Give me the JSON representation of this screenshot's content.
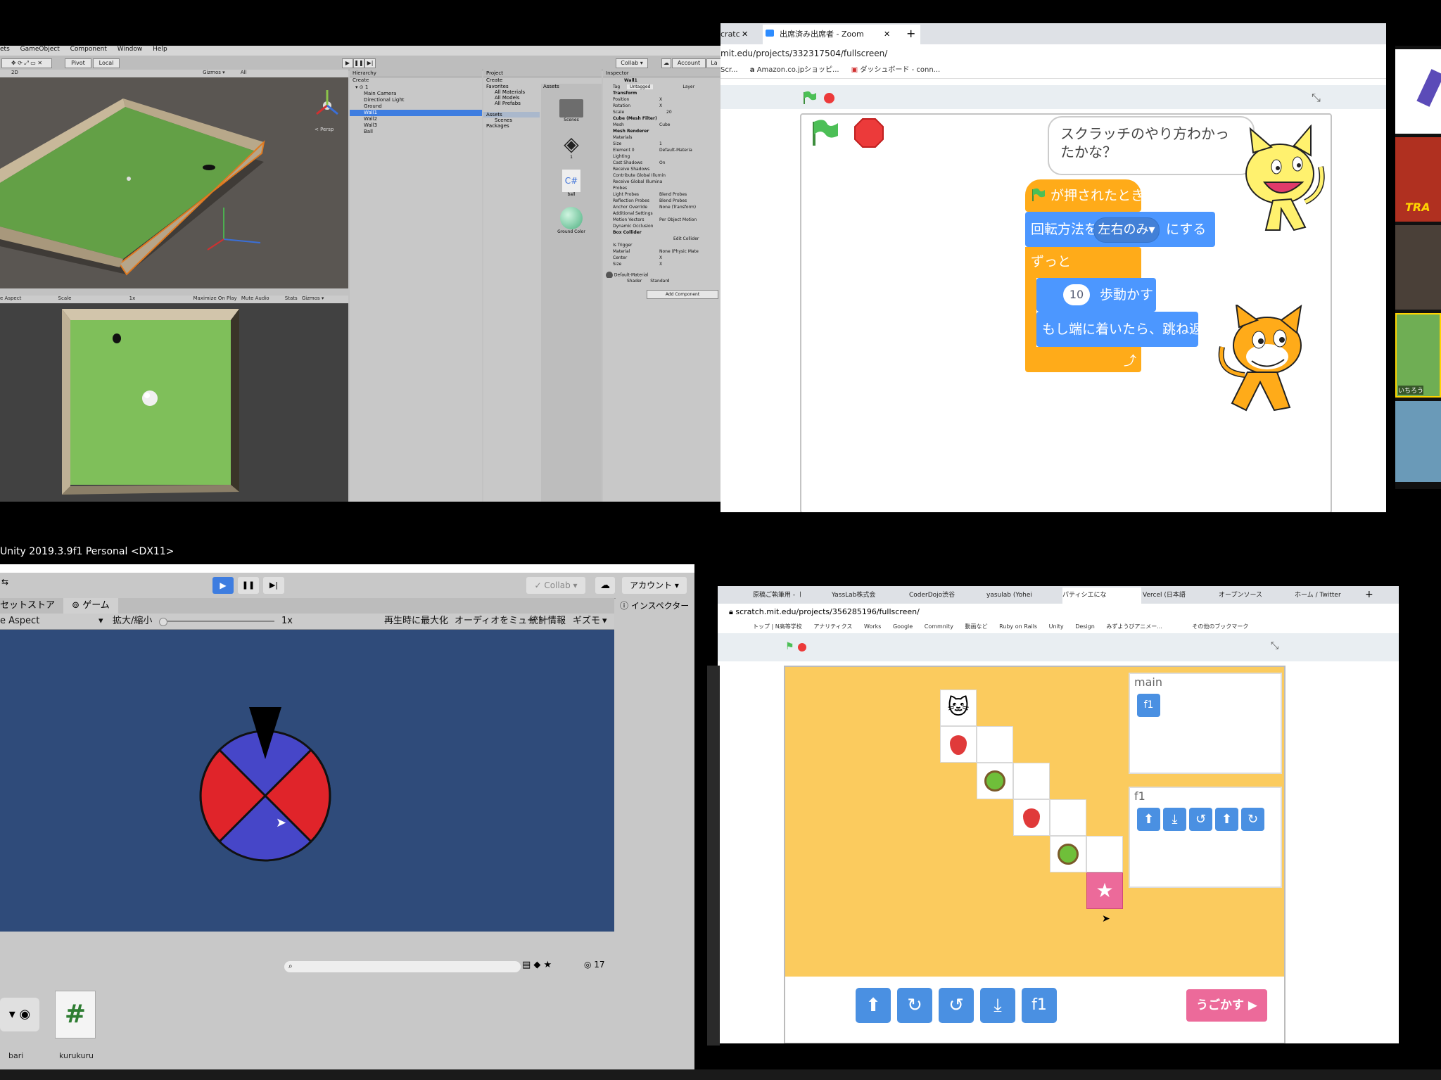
{
  "unity_top": {
    "menu": [
      "ets",
      "GameObject",
      "Component",
      "Window",
      "Help"
    ],
    "pivot": "Pivot",
    "local": "Local",
    "collab": "Collab ▾",
    "account": "Account",
    "layers": "La",
    "hierarchy": {
      "title": "Hierarchy",
      "create": "Create",
      "items": [
        "Main Camera",
        "Directional Light",
        "Ground",
        "Wall1",
        "Wall2",
        "Wall3",
        "Ball"
      ],
      "selected": "Wall1"
    },
    "project": {
      "title": "Project",
      "create": "Create",
      "favorites": "Favorites",
      "fav_items": [
        "All Materials",
        "All Models",
        "All Prefabs"
      ],
      "assets": "Assets",
      "asset_items": [
        "Scenes"
      ],
      "packages": "Packages",
      "grid_title": "Assets",
      "grid_items": [
        "Scenes",
        "1",
        "ball",
        "Ground Color"
      ]
    },
    "inspector": {
      "title": "Inspector",
      "object": "Wall1",
      "tag": "Tag",
      "tag_value": "Untagged",
      "layer": "Layer",
      "rows": [
        "Transform",
        "Position",
        "Rotation",
        "Scale",
        "Cube (Mesh Filter)",
        "Mesh",
        "Mesh Renderer",
        "Materials",
        "Size",
        "Element 0",
        "Lighting",
        "Cast Shadows",
        "Receive Shadows",
        "Contribute Global Illumin",
        "Receive Global Illumina",
        "Probes",
        "Light Probes",
        "Reflection Probes",
        "Anchor Override",
        "Additional Settings",
        "Motion Vectors",
        "Dynamic Occlusion",
        "Box Collider",
        "Is Trigger",
        "Material",
        "Center",
        "Size"
      ],
      "values": {
        "mesh": "Cube",
        "size": "1",
        "element0": "Default-Materia",
        "cast_shadows": "On",
        "light_probes": "Blend Probes",
        "reflection_probes": "Blend Probes",
        "anchor": "None (Transform)",
        "motion": "Per Object Motion",
        "material": "None (Physic Mate",
        "edit_collider": "Edit Collider",
        "x": "X",
        "y": "Y",
        "scale_val": "20"
      },
      "default_material": "Default-Material",
      "shader": "Shader",
      "shader_value": "Standard",
      "add_component": "Add Component"
    },
    "scene_hdr": [
      "2D",
      "Gizmos ▾",
      "All"
    ],
    "game_hdr": [
      "e Aspect",
      "Scale",
      "1x",
      "Maximize On Play",
      "Mute Audio",
      "Stats",
      "Gizmos ▾"
    ],
    "persp": "< Persp"
  },
  "scratch_top": {
    "tabs": [
      "cratc",
      "出席済み出席者 - Zoom"
    ],
    "url": "mit.edu/projects/332317504/fullscreen/",
    "bookmarks": [
      "Scr...",
      "Amazon.co.jpショッピ...",
      "ダッシュボード - conn..."
    ],
    "speech": "スクラッチのやり方わかったかな？",
    "blocks": {
      "hat": "が押されたとき",
      "rot_prefix": "回転方法を",
      "rot_value": "左右のみ",
      "rot_suffix": "にする",
      "forever": "ずっと",
      "steps": "10",
      "move": "歩動かす",
      "bounce": "もし端に着いたら、跳ね返る"
    }
  },
  "right_strip": {
    "name": "いちろう",
    "tra": "TRA"
  },
  "unity_bottom": {
    "title": "Unity 2019.3.9f1 Personal <DX11>",
    "collab": "Collab",
    "account": "アカウント",
    "tabs": [
      "セットストア",
      "ゲーム"
    ],
    "aspect": "e Aspect",
    "scale_label": "拡大/縮小",
    "scale_value": "1x",
    "opts": [
      "再生時に最大化",
      "オーディオをミュート",
      "統計情報",
      "ギズモ"
    ],
    "inspector": "インスペクター",
    "count": "17",
    "assets": [
      "bari",
      "kurukuru"
    ]
  },
  "scratch_bottom": {
    "tabs": [
      "原稿ご執筆用 - 〡",
      "YassLab株式会",
      "CoderDojo渋谷",
      "yasulab (Yohei",
      "パティシエにな",
      "Vercel (日本語",
      "オープンソース",
      "ホーム / Twitter"
    ],
    "url": "scratch.mit.edu/projects/356285196/fullscreen/",
    "bookmarks": [
      "トップ | N高等学校",
      "アナリティクス",
      "Works",
      "Google",
      "Commnity",
      "動画など",
      "Ruby on Rails",
      "Unity",
      "Design",
      "みずようびアニメー...",
      "その他のブックマーク"
    ],
    "main_label": "main",
    "f1_label": "f1",
    "f1_btn": "f1",
    "run": "うごかす ▶"
  }
}
